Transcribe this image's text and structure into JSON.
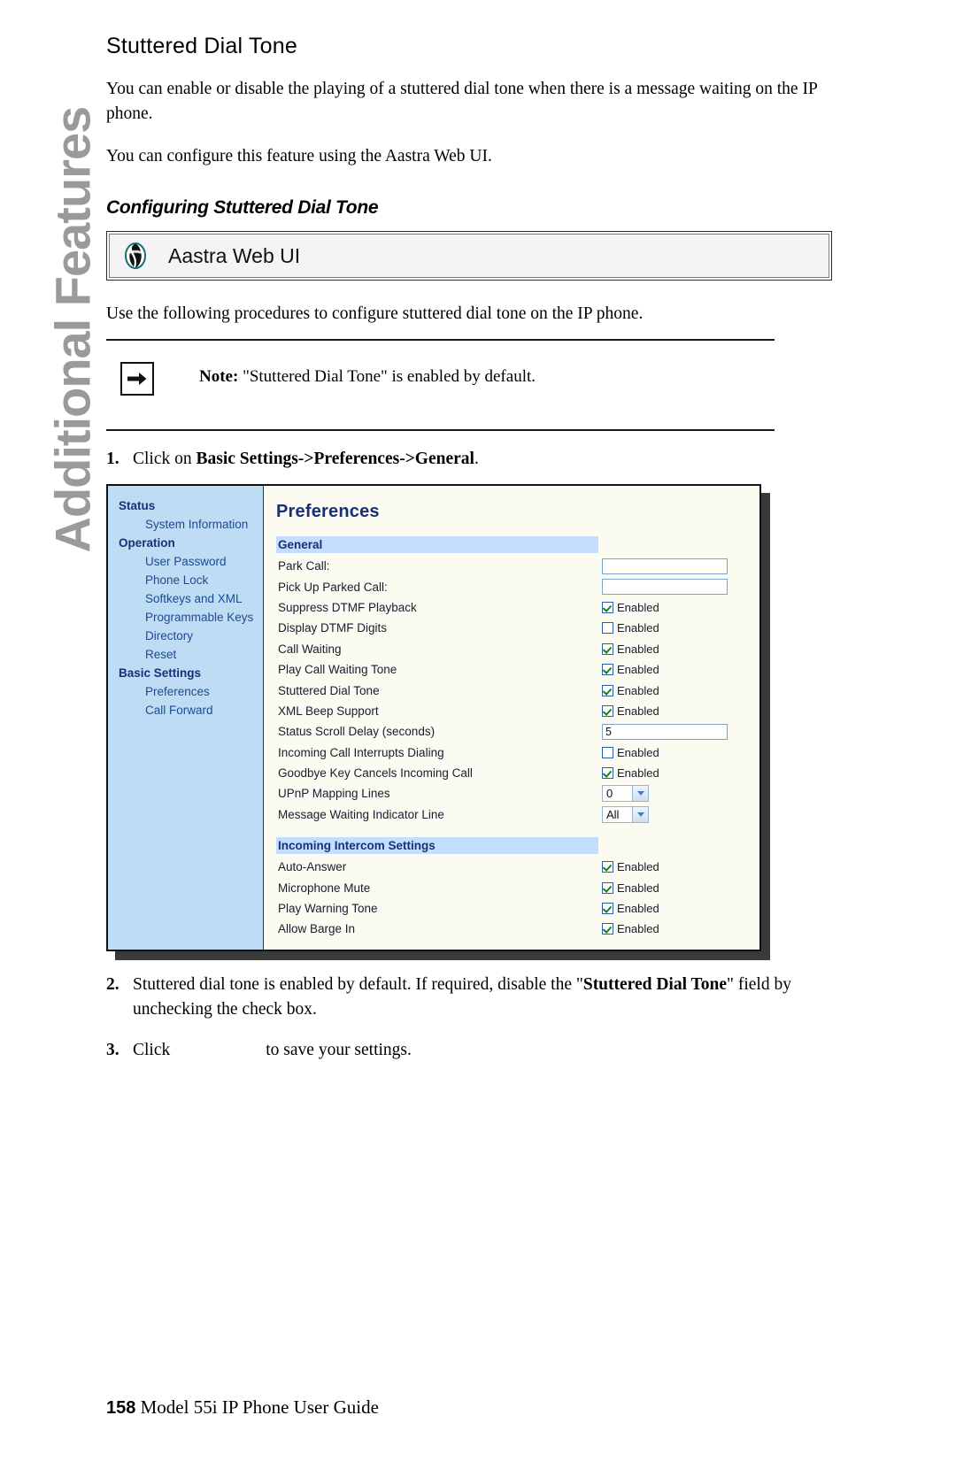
{
  "chapter_tab": "Additional Features",
  "page": {
    "title": "Stuttered Dial Tone",
    "paragraphs": [
      "You can enable or disable the playing of a stuttered dial tone when there is a message waiting on the IP phone.",
      "You can configure this feature using the Aastra Web UI."
    ],
    "subtitle": "Configuring Stuttered Dial Tone",
    "webui_banner": {
      "icon": "globe-icon",
      "label": "Aastra Web UI"
    },
    "use_line": "Use the following procedures to configure stuttered dial tone on the IP phone.",
    "note": {
      "icon": "right-arrow-icon",
      "bold_prefix": "Note:",
      "text": " \"Stuttered Dial Tone\" is enabled by default."
    },
    "steps": [
      {
        "num": "1.",
        "pre": "Click on ",
        "bold": "Basic Settings->Preferences->General",
        "post": "."
      },
      {
        "num": "2.",
        "pre": "Stuttered dial tone is enabled by default. If required, disable the \"",
        "bold": "Stuttered Dial Tone",
        "post": "\" field by unchecking the check box."
      },
      {
        "num": "3.",
        "pre": "Click",
        "bold": "",
        "post": "to save your settings."
      }
    ]
  },
  "webui": {
    "nav": [
      {
        "label": "Status",
        "type": "head"
      },
      {
        "label": "System Information",
        "type": "item"
      },
      {
        "label": "Operation",
        "type": "head"
      },
      {
        "label": "User Password",
        "type": "item"
      },
      {
        "label": "Phone Lock",
        "type": "item"
      },
      {
        "label": "Softkeys and XML",
        "type": "item"
      },
      {
        "label": "Programmable Keys",
        "type": "item"
      },
      {
        "label": "Directory",
        "type": "item"
      },
      {
        "label": "Reset",
        "type": "item"
      },
      {
        "label": "Basic Settings",
        "type": "head"
      },
      {
        "label": "Preferences",
        "type": "item"
      },
      {
        "label": "Call Forward",
        "type": "item"
      }
    ],
    "panel_title": "Preferences",
    "groups": [
      {
        "heading": "General",
        "rows": [
          {
            "label": "Park Call:",
            "control": "text",
            "value": ""
          },
          {
            "label": "Pick Up Parked Call:",
            "control": "text",
            "value": ""
          },
          {
            "label": "Suppress DTMF Playback",
            "control": "checkbox",
            "checked": true,
            "cb_label": "Enabled"
          },
          {
            "label": "Display DTMF Digits",
            "control": "checkbox",
            "checked": false,
            "cb_label": "Enabled"
          },
          {
            "label": "Call Waiting",
            "control": "checkbox",
            "checked": true,
            "cb_label": "Enabled"
          },
          {
            "label": "Play Call Waiting Tone",
            "control": "checkbox",
            "checked": true,
            "cb_label": "Enabled"
          },
          {
            "label": "Stuttered Dial Tone",
            "control": "checkbox",
            "checked": true,
            "cb_label": "Enabled"
          },
          {
            "label": "XML Beep Support",
            "control": "checkbox",
            "checked": true,
            "cb_label": "Enabled"
          },
          {
            "label": "Status Scroll Delay (seconds)",
            "control": "text",
            "value": "5"
          },
          {
            "label": "Incoming Call Interrupts Dialing",
            "control": "checkbox",
            "checked": false,
            "cb_label": "Enabled"
          },
          {
            "label": "Goodbye Key Cancels Incoming Call",
            "control": "checkbox",
            "checked": true,
            "cb_label": "Enabled"
          },
          {
            "label": "UPnP Mapping Lines",
            "control": "select",
            "value": "0"
          },
          {
            "label": "Message Waiting Indicator Line",
            "control": "select",
            "value": "All"
          }
        ]
      },
      {
        "heading": "Incoming Intercom Settings",
        "rows": [
          {
            "label": "Auto-Answer",
            "control": "checkbox",
            "checked": true,
            "cb_label": "Enabled"
          },
          {
            "label": "Microphone Mute",
            "control": "checkbox",
            "checked": true,
            "cb_label": "Enabled"
          },
          {
            "label": "Play Warning Tone",
            "control": "checkbox",
            "checked": true,
            "cb_label": "Enabled"
          },
          {
            "label": "Allow Barge In",
            "control": "checkbox",
            "checked": true,
            "cb_label": "Enabled"
          }
        ]
      }
    ]
  },
  "footer": {
    "page_number": "158",
    "text": "Model 55i IP Phone User Guide"
  },
  "colors": {
    "nav_bg": "#bedcf4",
    "group_head_bg": "#c3deff",
    "nav_text": "#1d4b8f",
    "heading_blue": "#1a2f7a",
    "check_green": "#1a7f1a",
    "tab_gray": "#9a9a9a"
  }
}
